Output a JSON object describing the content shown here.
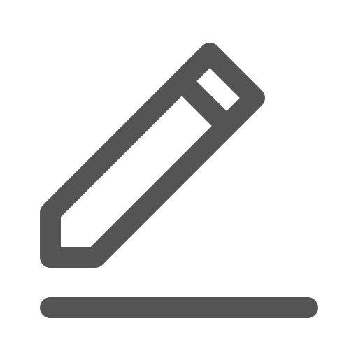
{
  "icon": {
    "name": "edit-icon",
    "color": "#545454",
    "background": "#ffffff"
  }
}
